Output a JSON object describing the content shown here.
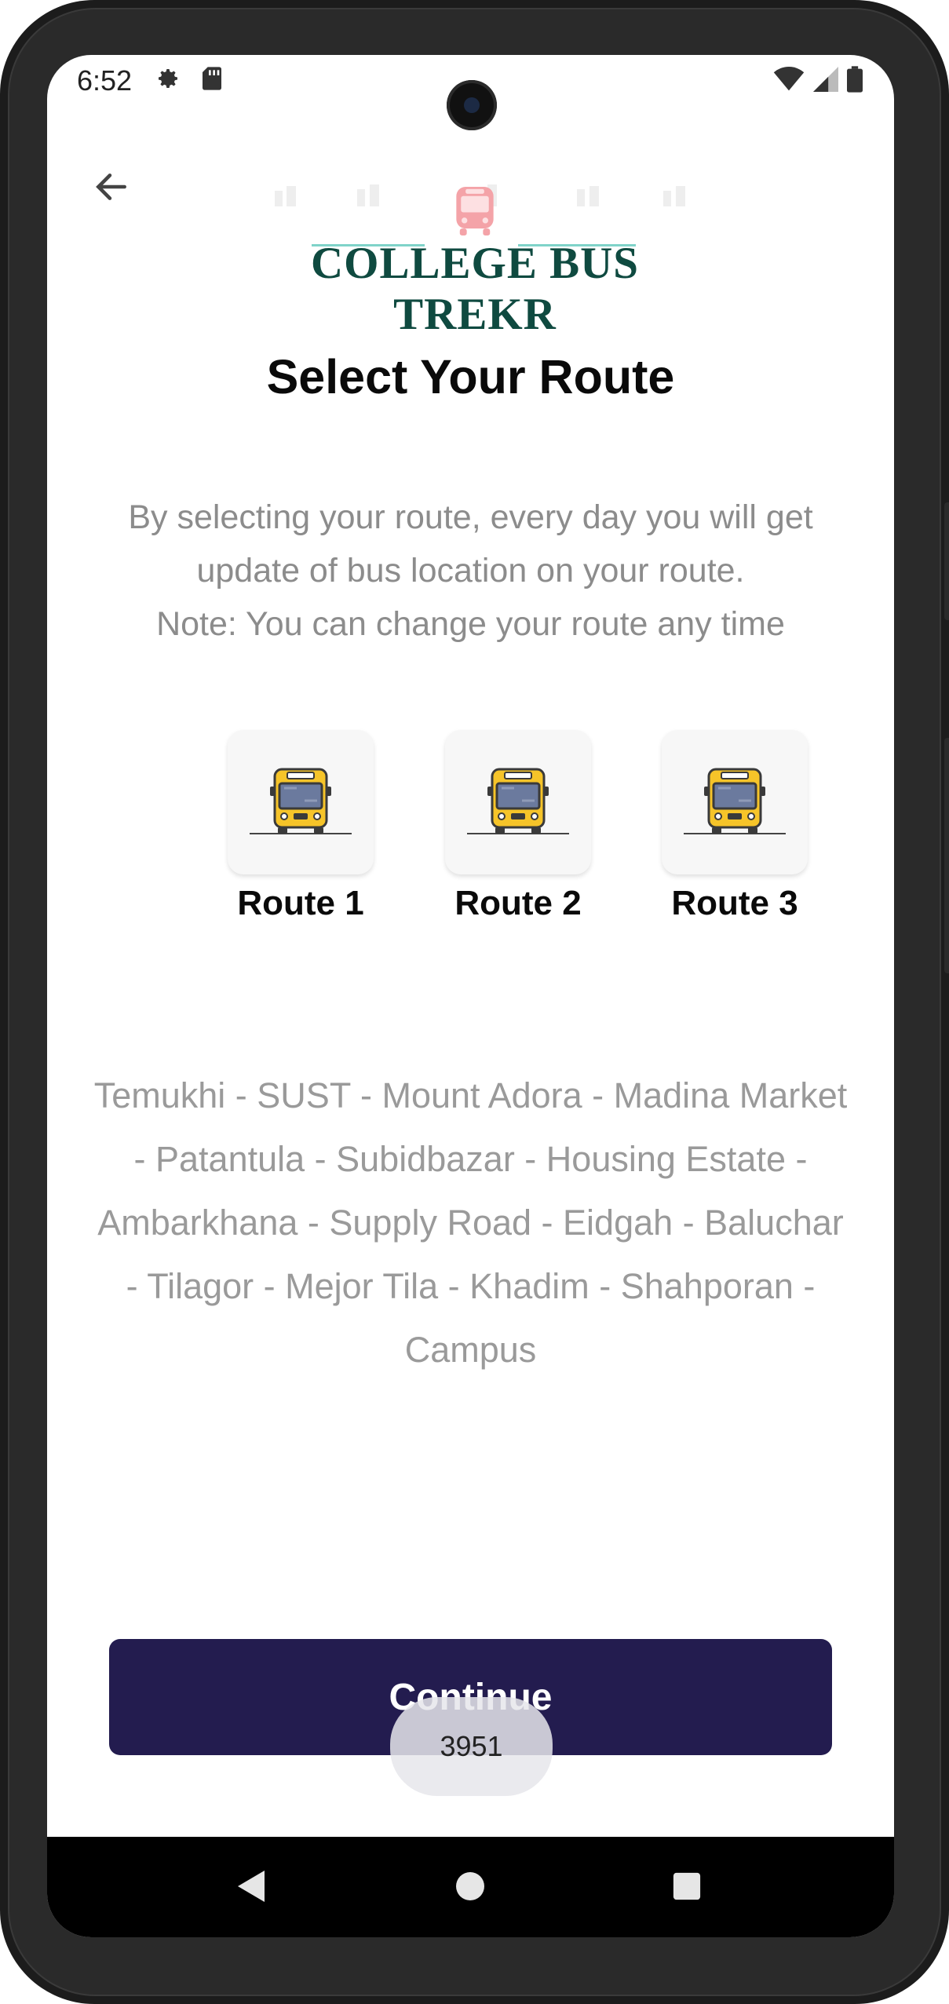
{
  "status_bar": {
    "time": "6:52",
    "left_icons": [
      "gear-icon",
      "sd-card-icon"
    ],
    "right_icons": [
      "wifi-icon",
      "signal-icon",
      "battery-icon"
    ]
  },
  "header": {
    "back_icon": "arrow-left-icon",
    "logo_text": "COLLEGE BUS TREKR"
  },
  "page": {
    "title": "Select Your Route",
    "description_lines": [
      "By selecting your route, every day you will get",
      "update of bus location on your route.",
      "Note: You can change your route any time"
    ]
  },
  "routes": [
    {
      "label": "Route 1",
      "icon": "bus-icon"
    },
    {
      "label": "Route 2",
      "icon": "bus-icon"
    },
    {
      "label": "Route 3",
      "icon": "bus-icon"
    }
  ],
  "stops_lines": [
    "Temukhi - SUST - Mount Adora - Madina Market",
    "- Patantula - Subidbazar - Housing Estate -",
    "Ambarkhana - Supply Road - Eidgah - Baluchar",
    "- Tilagor - Mejor Tila - Khadim - Shahporan -",
    "Campus"
  ],
  "continue_button": {
    "label": "Continue"
  },
  "toast": {
    "text": "3951"
  },
  "colors": {
    "primary_button": "#231c4f",
    "logo_text": "#0f4a40",
    "bus_yellow": "#f6c429"
  },
  "nav_bar": {
    "icons": [
      "back-triangle-icon",
      "home-circle-icon",
      "recents-square-icon"
    ]
  }
}
